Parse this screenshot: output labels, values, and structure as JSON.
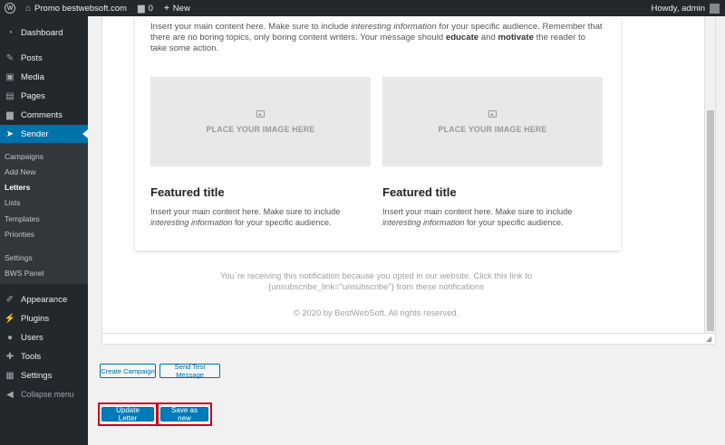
{
  "adminbar": {
    "site_name": "Promo bestwebsoft.com",
    "comments_count": "0",
    "new_label": "New",
    "howdy": "Howdy, admin"
  },
  "sidebar": {
    "items": [
      {
        "label": "Dashboard",
        "icon": "dashboard-icon"
      },
      {
        "label": "Posts",
        "icon": "pin-icon"
      },
      {
        "label": "Media",
        "icon": "media-icon"
      },
      {
        "label": "Pages",
        "icon": "pages-icon"
      },
      {
        "label": "Comments",
        "icon": "comment-icon"
      },
      {
        "label": "Sender",
        "icon": "paper-plane-icon"
      },
      {
        "label": "Appearance",
        "icon": "brush-icon"
      },
      {
        "label": "Plugins",
        "icon": "plug-icon"
      },
      {
        "label": "Users",
        "icon": "user-icon"
      },
      {
        "label": "Tools",
        "icon": "wrench-icon"
      },
      {
        "label": "Settings",
        "icon": "settings-icon"
      },
      {
        "label": "Collapse menu",
        "icon": "collapse-icon"
      }
    ],
    "submenu": [
      "Campaigns",
      "Add New",
      "Letters",
      "Lists",
      "Templates",
      "Priorities",
      "Settings",
      "BWS Panel"
    ],
    "current_sub": "Letters"
  },
  "letter": {
    "intro_1": "Insert your main content here. Make sure to include ",
    "intro_em": "interesting information",
    "intro_2": " for your specific audience. Remember that there are no boring topics, only boring content writers. Your message should ",
    "intro_b1": "educate",
    "intro_3": " and ",
    "intro_b2": "motivate",
    "intro_4": " the reader to take some action.",
    "image_placeholder": "PLACE YOUR IMAGE HERE",
    "featured_title": "Featured title",
    "feat_text_1": "Insert your main content here. Make sure to include ",
    "feat_text_em": "interesting information",
    "feat_text_2": " for your specific audience.",
    "notice": "You`re receiving this notification because you opted in our website. Click this link to {unsubscribe_link=\"unsubscribe\"} from these notifications",
    "copyright": "© 2020 by BestWebSoft. All rights reserved."
  },
  "buttons": {
    "create_campaign": "Create Campaign",
    "send_test": "Send Test Message",
    "update_letter": "Update Letter",
    "save_as_new": "Save as new"
  },
  "colors": {
    "admin_dark": "#23282d",
    "accent": "#0073aa",
    "highlight_border": "#d0021b"
  }
}
